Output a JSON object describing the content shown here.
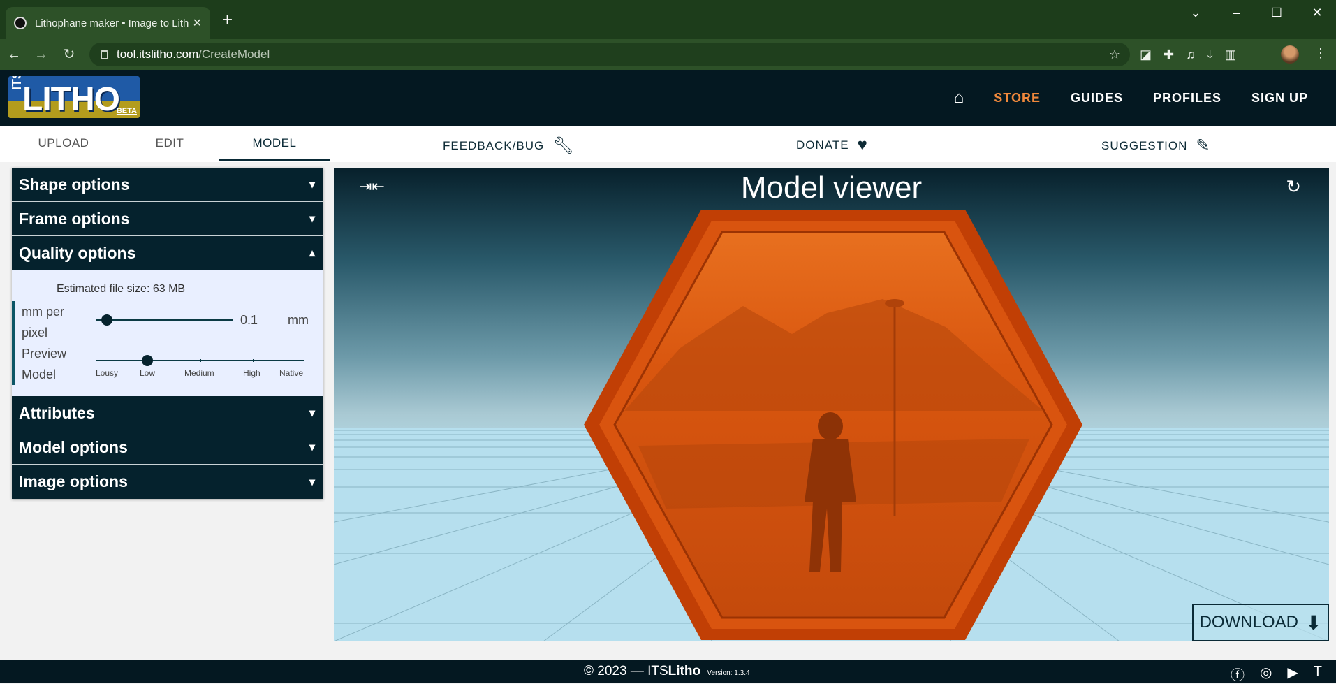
{
  "browser": {
    "tab_title": "Lithophane maker • Image to Lith",
    "tab_close": "✕",
    "new_tab": "+",
    "url_host": "tool.itslitho.com",
    "url_path": "/CreateModel",
    "window_controls": [
      "⌄",
      "–",
      "☐",
      "✕"
    ]
  },
  "site": {
    "logo_its": "ITS",
    "logo_litho": "LITHO",
    "logo_beta": "BETA",
    "nav": [
      "STORE",
      "GUIDES",
      "PROFILES",
      "SIGN UP"
    ],
    "accent": "#f0883c"
  },
  "subtabs": [
    "UPLOAD",
    "EDIT",
    "MODEL"
  ],
  "sublinks": {
    "feedback": "FEEDBACK/BUG",
    "donate": "DONATE",
    "suggestion": "SUGGESTION"
  },
  "accordion": {
    "sections": [
      "Shape options",
      "Frame options",
      "Quality options",
      "Attributes",
      "Model options",
      "Image options"
    ],
    "quality": {
      "file_size": "Estimated file size: 63 MB",
      "mm_label": "mm per pixel",
      "mm_value": "0.1",
      "mm_unit": "mm",
      "preview_label": "Preview Model",
      "preview_levels": [
        "Lousy",
        "Low",
        "Medium",
        "High",
        "Native"
      ],
      "preview_selected": "Low"
    }
  },
  "viewer": {
    "title": "Model viewer",
    "download": "DOWNLOAD"
  },
  "footer": {
    "copyright": "© 2023 — ITS",
    "brand": "Litho",
    "version": "Version: 1.3.4"
  }
}
